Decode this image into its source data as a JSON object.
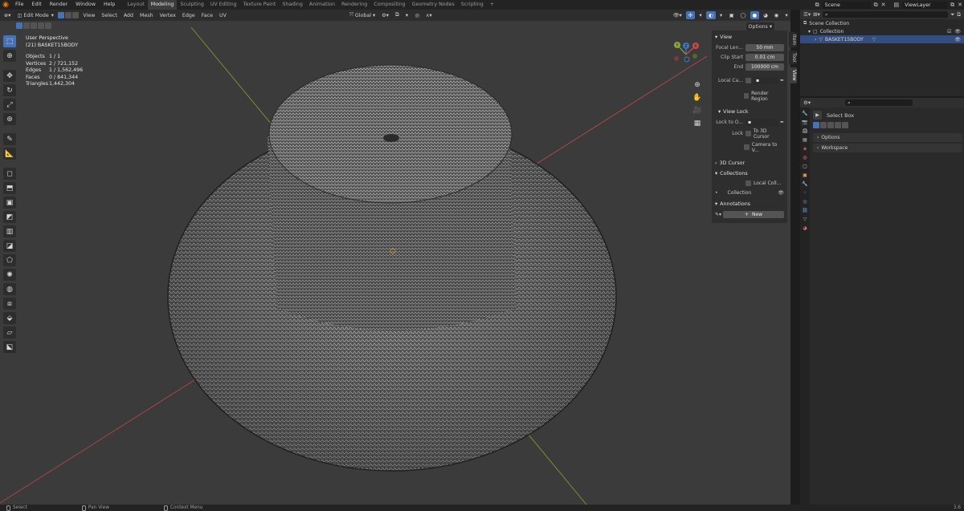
{
  "topbar": {
    "menus": [
      "File",
      "Edit",
      "Render",
      "Window",
      "Help"
    ],
    "workspace_tabs": [
      "Layout",
      "Modeling",
      "Sculpting",
      "UV Editing",
      "Texture Paint",
      "Shading",
      "Animation",
      "Rendering",
      "Compositing",
      "Geometry Nodes",
      "Scripting"
    ],
    "active_tab": "Modeling",
    "add_tab": "+",
    "scene": "Scene",
    "view_layer": "ViewLayer"
  },
  "viewport_header": {
    "mode": "Edit Mode",
    "menus": [
      "View",
      "Select",
      "Add",
      "Mesh",
      "Vertex",
      "Edge",
      "Face",
      "UV"
    ],
    "orientation": "Global",
    "options": "Options"
  },
  "overlay": {
    "view_name": "User Perspective",
    "object_name": "(21) BASKET15BODY",
    "stats": [
      {
        "label": "Objects",
        "value": "1 / 1"
      },
      {
        "label": "Vertices",
        "value": "2 / 721,152"
      },
      {
        "label": "Edges",
        "value": "1 / 1,562,496"
      },
      {
        "label": "Faces",
        "value": "0 / 841,344"
      },
      {
        "label": "Triangles",
        "value": "1,442,304"
      }
    ]
  },
  "gizmo": {
    "x": "X",
    "y": "Y",
    "z": "Z"
  },
  "npanel": {
    "view_title": "View",
    "focal_label": "Focal Len...",
    "focal_value": "50 mm",
    "clip_start_label": "Clip Start",
    "clip_start_value": "0.01 cm",
    "clip_end_label": "End",
    "clip_end_value": "100000 cm",
    "local_camera_label": "Local Ca...",
    "render_region": "Render Region",
    "view_lock_title": "View Lock",
    "lock_to_label": "Lock to O...",
    "lock_label": "Lock",
    "to_3d_cursor": "To 3D Cursor",
    "camera_to_view": "Camera to V...",
    "cursor_title": "3D Cursor",
    "collections_title": "Collections",
    "local_collections": "Local Coll...",
    "collection_name": "Collection",
    "annotations_title": "Annotations",
    "new_button": "New",
    "tabs": [
      "Item",
      "Tool",
      "View"
    ],
    "active_tab": "View"
  },
  "outliner": {
    "scene_collection": "Scene Collection",
    "collection": "Collection",
    "object": "BASKET15BODY"
  },
  "properties": {
    "select_box": "Select Box",
    "options": "Options",
    "workspace": "Workspace"
  },
  "statusbar": {
    "select": "Select",
    "pan_view": "Pan View",
    "context_menu": "Context Menu",
    "version": "3.6"
  },
  "colors": {
    "accent": "#4772b3",
    "x_axis": "#b34848",
    "y_axis": "#7a9a2e",
    "wire": "#c9c9c9",
    "viewport_bg": "#3b3b3b"
  }
}
